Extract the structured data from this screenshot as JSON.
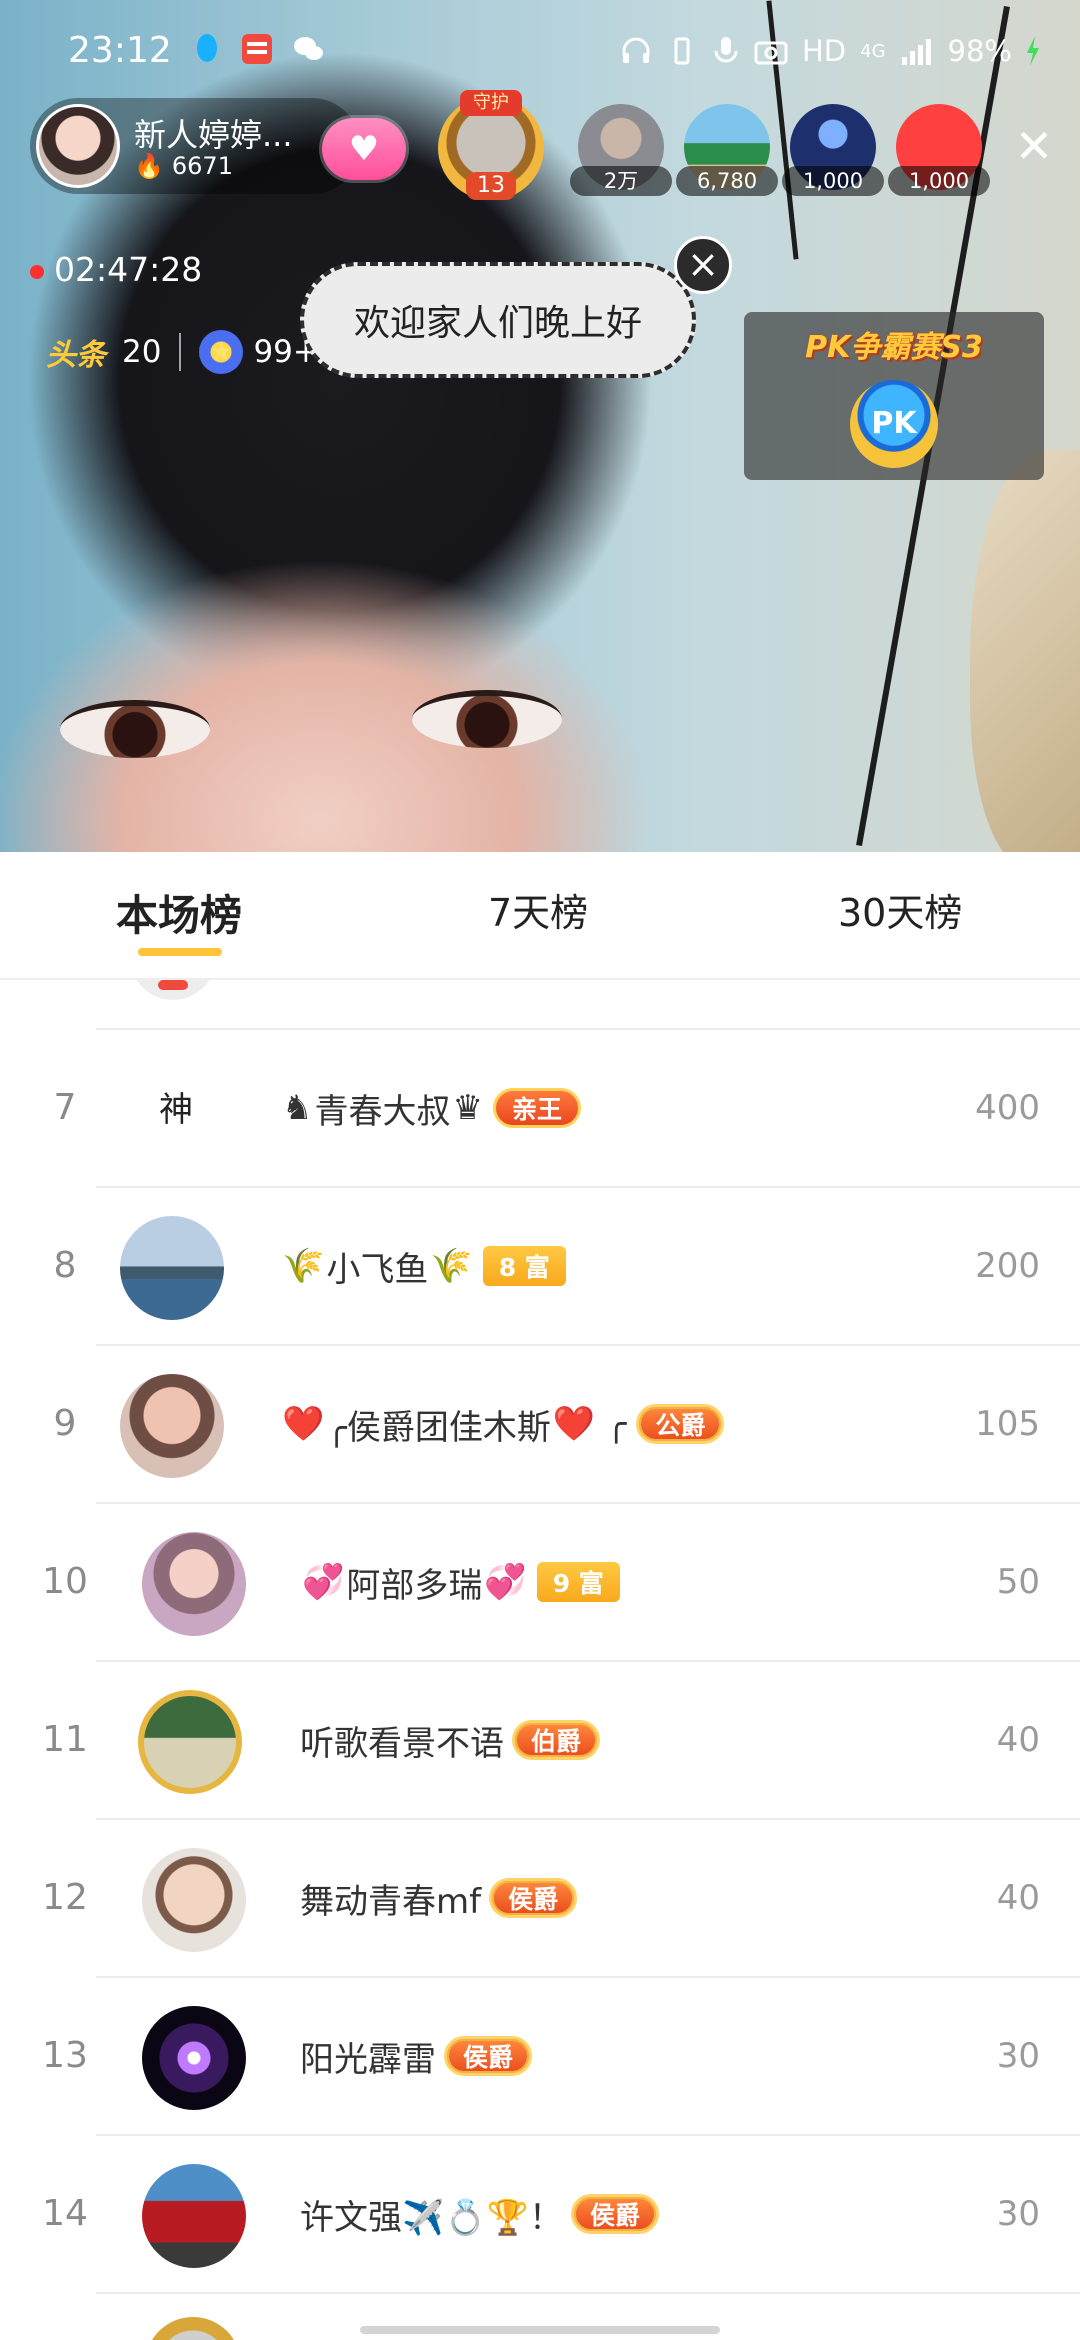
{
  "status_bar": {
    "time": "23:12",
    "right_text": "HD",
    "network": "4G",
    "battery": "98%"
  },
  "host": {
    "name": "新人婷婷...",
    "fans": "6671"
  },
  "guard": {
    "label": "守护",
    "level": "13"
  },
  "viewers": [
    {
      "count": "2万"
    },
    {
      "count": "6,780"
    },
    {
      "count": "1,000"
    },
    {
      "count": "1,000"
    }
  ],
  "live_timer": "02:47:28",
  "stats": {
    "toutiao_logo": "头条",
    "toutiao_count": "20",
    "star_count": "99+"
  },
  "bubble": {
    "text": "欢迎家人们晚上好"
  },
  "pk": {
    "title": "PK争霸赛S3",
    "button": "PK"
  },
  "tabs": [
    {
      "label": "本场榜"
    },
    {
      "label": "7天榜"
    },
    {
      "label": "30天榜"
    }
  ],
  "rows": [
    {
      "rank": "7",
      "prefix": "♞",
      "name": "青春大叔",
      "suffix": "♛",
      "badge": "亲王",
      "badge_type": "king",
      "score": "400",
      "avatar_text": "神"
    },
    {
      "rank": "8",
      "prefix": "🌾",
      "name": "小飞鱼",
      "suffix": "🌾",
      "badge": "8 富",
      "badge_type": "rich",
      "score": "200"
    },
    {
      "rank": "9",
      "prefix": "❤️",
      "name": "╭侯爵团佳木斯",
      "suffix": "❤️ ╭",
      "badge": "公爵",
      "badge_type": "noble",
      "score": "105"
    },
    {
      "rank": "10",
      "prefix": "💞",
      "name": "阿部多瑞",
      "suffix": "💞",
      "badge": "9 富",
      "badge_type": "rich",
      "score": "50"
    },
    {
      "rank": "11",
      "prefix": "",
      "name": "听歌看景不语",
      "suffix": "",
      "badge": "伯爵",
      "badge_type": "noble",
      "score": "40"
    },
    {
      "rank": "12",
      "prefix": "",
      "name": "舞动青春mf",
      "suffix": "",
      "badge": "侯爵",
      "badge_type": "noble",
      "score": "40"
    },
    {
      "rank": "13",
      "prefix": "",
      "name": "阳光霹雷",
      "suffix": "",
      "badge": "侯爵",
      "badge_type": "noble",
      "score": "30"
    },
    {
      "rank": "14",
      "prefix": "",
      "name": "许文强✈️💍🏆！",
      "suffix": "",
      "badge": "侯爵",
      "badge_type": "noble",
      "score": "30"
    }
  ],
  "colors": {
    "accent": "#ffc53a",
    "rank_text": "#8a8a8a",
    "score_text": "#9a9a9a"
  }
}
